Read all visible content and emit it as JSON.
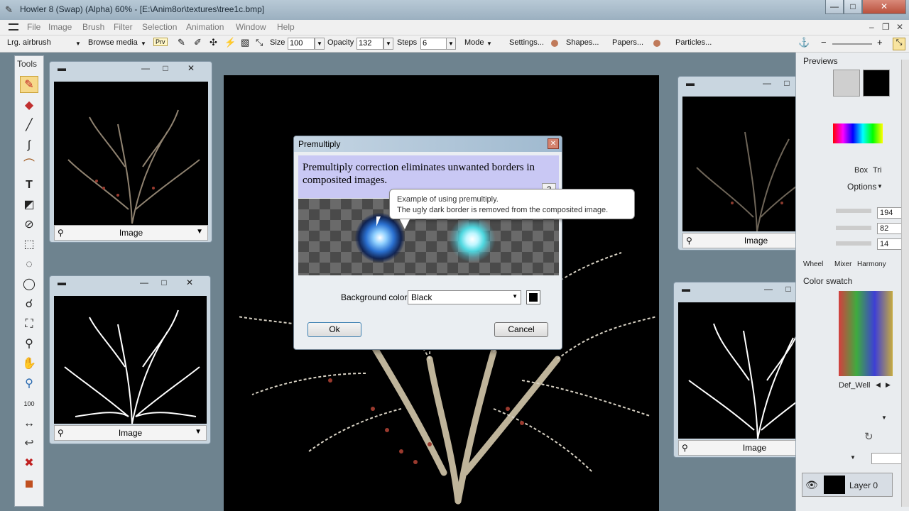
{
  "window": {
    "title": "Howler 8  (Swap)  (Alpha)  60%   - [E:\\Anim8or\\textures\\tree1c.bmp]"
  },
  "menu": [
    "File",
    "Image",
    "Brush",
    "Filter",
    "Selection",
    "Animation",
    "Window",
    "Help"
  ],
  "toolbar": {
    "brush": "Lrg. airbrush",
    "browse": "Browse media",
    "prv": "Prv",
    "size_label": "Size",
    "size": "100",
    "opacity_label": "Opacity",
    "opacity": "132",
    "steps_label": "Steps",
    "steps": "6",
    "mode": "Mode",
    "settings": "Settings...",
    "shapes": "Shapes...",
    "papers": "Papers...",
    "particles": "Particles..."
  },
  "tools_title": "Tools",
  "subwindows": [
    {
      "label": "Image"
    },
    {
      "label": "Image"
    },
    {
      "label": "Image"
    },
    {
      "label": "Image"
    }
  ],
  "right": {
    "previews": "Previews",
    "tabs": [
      "Box",
      "Tri"
    ],
    "options": "Options",
    "values": [
      "194",
      "82",
      "14"
    ],
    "color_tabs": [
      "Wheel",
      "Mixer",
      "Harmony"
    ],
    "color_swatch": "Color swatch",
    "def_well": "Def_Well",
    "layer": "Layer 0"
  },
  "dialog": {
    "title": "Premultiply",
    "heading": "Premultiply correction eliminates unwanted borders in composited images.",
    "help": "?",
    "bg_label": "Background color",
    "bg_value": "Black",
    "ok": "Ok",
    "cancel": "Cancel"
  },
  "tooltip": {
    "line1": "Example of using premultiply.",
    "line2": "The ugly dark border is removed from the composited image."
  }
}
